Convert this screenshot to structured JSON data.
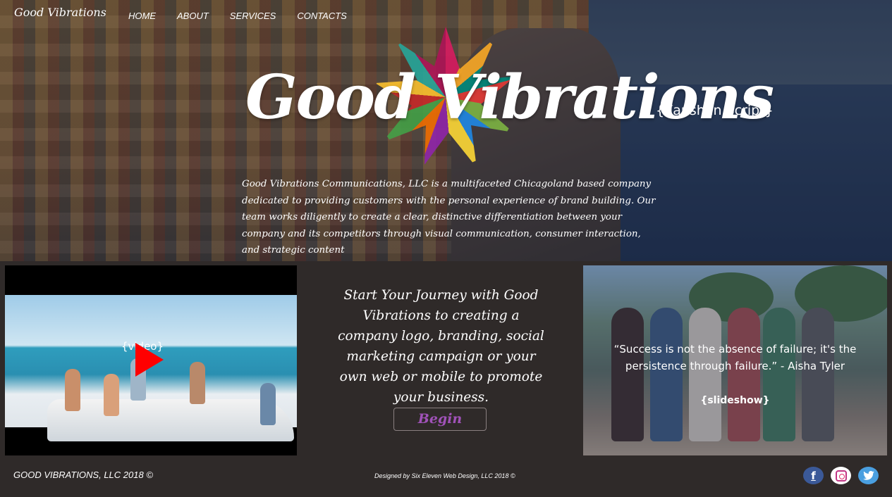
{
  "brand": {
    "logo_text": "Good Vibrations"
  },
  "nav": {
    "items": [
      "HOME",
      "ABOUT",
      "SERVICES",
      "CONTACTS"
    ]
  },
  "hero": {
    "title": "Good Vibrations",
    "font_note": "{Kaushan Script}",
    "intro": "Good Vibrations Communications, LLC is a multifaceted Chicagoland based company dedicated to providing customers with the personal experience of brand building. Our team works diligently to create a clear, distinctive differentiation between your company and its competitors through visual communication, consumer interaction, and strategic content"
  },
  "video": {
    "label": "{video}",
    "play_color": "#ff0000"
  },
  "cta": {
    "text": "Start Your Journey with Good Vibrations to creating a company logo, branding, social marketing campaign or your own web or mobile  to promote your business.",
    "button_label": "Begin",
    "button_color": "#a052b8"
  },
  "slideshow": {
    "quote": "“Success is not the absence of failure; it's the persistence through failure.” - Aisha Tyler",
    "label": "{slideshow}"
  },
  "footer": {
    "copyright": "GOOD VIBRATIONS, LLC 2018 ©",
    "credit": "Designed by Six Eleven Web Design, LLC 2018 ©",
    "social": [
      {
        "name": "facebook-icon",
        "glyph": "f",
        "color": "#3b5998"
      },
      {
        "name": "instagram-icon",
        "glyph": "",
        "color": "#c13584"
      },
      {
        "name": "twitter-icon",
        "glyph": "🐦",
        "color": "#4a9fe0"
      }
    ]
  },
  "colors": {
    "background": "#2f2a29",
    "text": "#ffffff"
  }
}
